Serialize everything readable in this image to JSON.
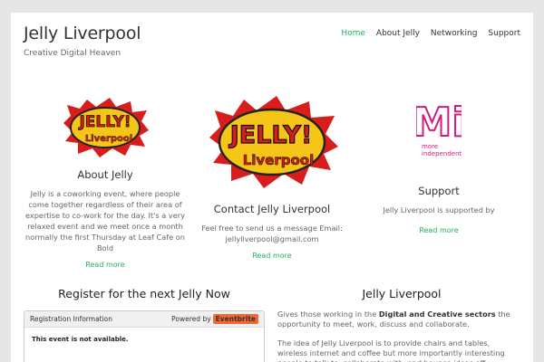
{
  "header": {
    "site_title": "Jelly Liverpool",
    "tagline": "Creative Digital Heaven",
    "nav": [
      "Home",
      "About Jelly",
      "Networking",
      "Support"
    ]
  },
  "columns": {
    "about": {
      "logo_text_1": "JELLY!",
      "logo_text_2": "Liverpool",
      "title": "About Jelly",
      "body": "Jelly is a coworking event, where people come together regardless of their area of expertise to co-work for the day. It's a very relaxed event and we meet once a month normally the first Thursday at Leaf Cafe on Bold",
      "more": "Read more"
    },
    "contact": {
      "logo_text_1": "JELLY!",
      "logo_text_2": "Liverpool",
      "title": "Contact Jelly Liverpool",
      "body": "Feel free to send us a message Email: jellyliverpool@gmail.com",
      "more": "Read more"
    },
    "support": {
      "logo_mark": "Mi",
      "logo_line_1": "more",
      "logo_line_2": "independent",
      "title": "Support",
      "body": "Jelly Liverpool is supported by",
      "more": "Read more"
    }
  },
  "registration": {
    "heading": "Register for the next Jelly Now",
    "box_title": "Registration Information",
    "powered_by": "Powered by",
    "eventbrite": "Eventbrite",
    "message": "This event is not available."
  },
  "info": {
    "heading": "Jelly Liverpool",
    "p1_prefix": "Gives those working in the ",
    "p1_bold": "Digital and Creative sectors",
    "p1_suffix": " the opportunity to meet, work, discuss and collaborate.",
    "p2": "The idea of Jelly Liverpool is to provide chairs and tables, wireless internet and coffee but more importantly interesting people to talk to, collaborate with, and bounce ideas off."
  },
  "colors": {
    "accent": "#27ae60",
    "jelly_yellow": "#f5c518",
    "jelly_red": "#d91c1c",
    "mi_magenta": "#d6197f"
  }
}
